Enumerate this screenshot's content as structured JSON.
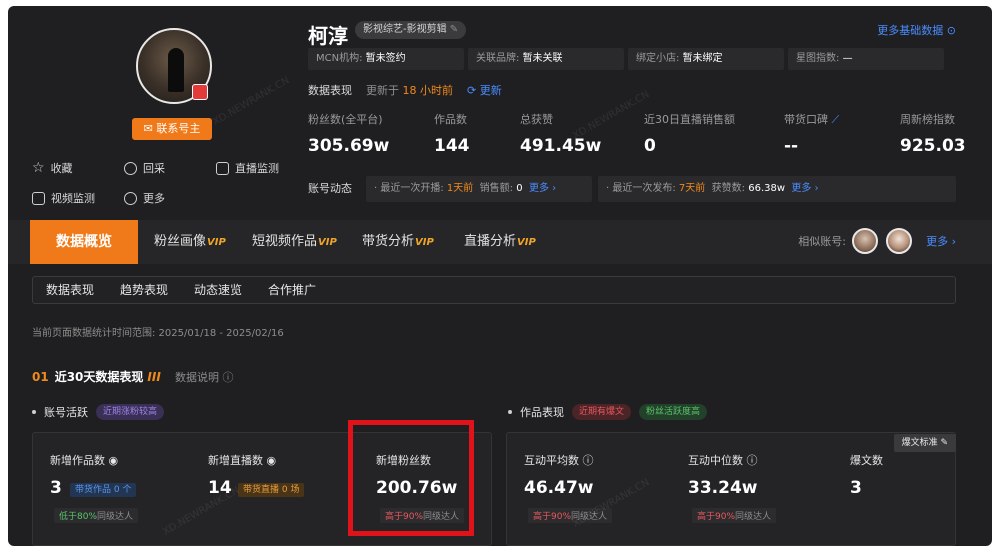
{
  "profile": {
    "name": "柯淳",
    "tag": "影视综艺-影视剪辑",
    "contact_label": "联系号主",
    "more_basic": "更多基础数据"
  },
  "actions": [
    {
      "label": "收藏",
      "icon": "star-icon"
    },
    {
      "label": "回采",
      "icon": "refresh-icon"
    },
    {
      "label": "直播监测",
      "icon": "live-icon"
    },
    {
      "label": "视频监测",
      "icon": "chart-icon"
    },
    {
      "label": "更多",
      "icon": "more-icon"
    }
  ],
  "info": [
    {
      "key": "MCN机构:",
      "value": "暂未签约"
    },
    {
      "key": "关联品牌:",
      "value": "暂未关联"
    },
    {
      "key": "绑定小店:",
      "value": "暂未绑定"
    },
    {
      "key": "星图指数:",
      "value": "—"
    }
  ],
  "performance": {
    "label": "数据表现",
    "updated_prefix": "更新于",
    "updated_time": "18 小时前",
    "refresh_label": "更新"
  },
  "stats": [
    {
      "label": "粉丝数(全平台)",
      "value": "305.69w"
    },
    {
      "label": "作品数",
      "value": "144"
    },
    {
      "label": "总获赞",
      "value": "491.45w"
    },
    {
      "label": "近30日直播销售额",
      "value": "0"
    },
    {
      "label": "带货口碑",
      "value": "--"
    },
    {
      "label": "周新榜指数",
      "value": "925.03"
    }
  ],
  "dynamics": {
    "label": "账号动态",
    "live": {
      "prefix": "最近一次开播:",
      "time": "1天前",
      "sales_label": "销售额:",
      "sales": "0",
      "more": "更多 ›"
    },
    "post": {
      "prefix": "最近一次发布:",
      "time": "7天前",
      "likes_label": "获赞数:",
      "likes": "66.38w",
      "more": "更多 ›"
    }
  },
  "tabs": [
    {
      "label": "数据概览",
      "vip": ""
    },
    {
      "label": "粉丝画像",
      "vip": "VIP"
    },
    {
      "label": "短视频作品",
      "vip": "VIP"
    },
    {
      "label": "带货分析",
      "vip": "VIP"
    },
    {
      "label": "直播分析",
      "vip": "VIP"
    }
  ],
  "similar": {
    "label": "相似账号:",
    "more": "更多 ›"
  },
  "subnav": [
    "数据表现",
    "趋势表现",
    "动态速览",
    "合作推广"
  ],
  "range_text": "当前页面数据统计时间范围: 2025/01/18 - 2025/02/16",
  "section": {
    "num": "01",
    "title": "近30天数据表现",
    "bars": "III",
    "note": "数据说明"
  },
  "groups": {
    "account": {
      "label": "账号活跃",
      "chip": "近期涨粉较高"
    },
    "works": {
      "label": "作品表现",
      "chip1": "近期有爆文",
      "chip2": "粉丝活跃度高"
    }
  },
  "metrics": [
    {
      "label": "新增作品数",
      "value": "3",
      "tag": "带货作品 0 个",
      "cmp_hl": "低于80%",
      "cmp_rest": "同级达人"
    },
    {
      "label": "新增直播数",
      "value": "14",
      "tag": "带货直播 0 场"
    },
    {
      "label": "新增粉丝数",
      "value": "200.76w",
      "cmp_hl": "高于90%",
      "cmp_rest": "同级达人"
    },
    {
      "label": "互动平均数",
      "value": "46.47w",
      "cmp_hl": "高于90%",
      "cmp_rest": "同级达人"
    },
    {
      "label": "互动中位数",
      "value": "33.24w",
      "cmp_hl": "高于90%",
      "cmp_rest": "同级达人"
    },
    {
      "label": "爆文数",
      "value": "3"
    }
  ],
  "std_button": "爆文标准",
  "watermark": "XD.NEWRANK.CN"
}
